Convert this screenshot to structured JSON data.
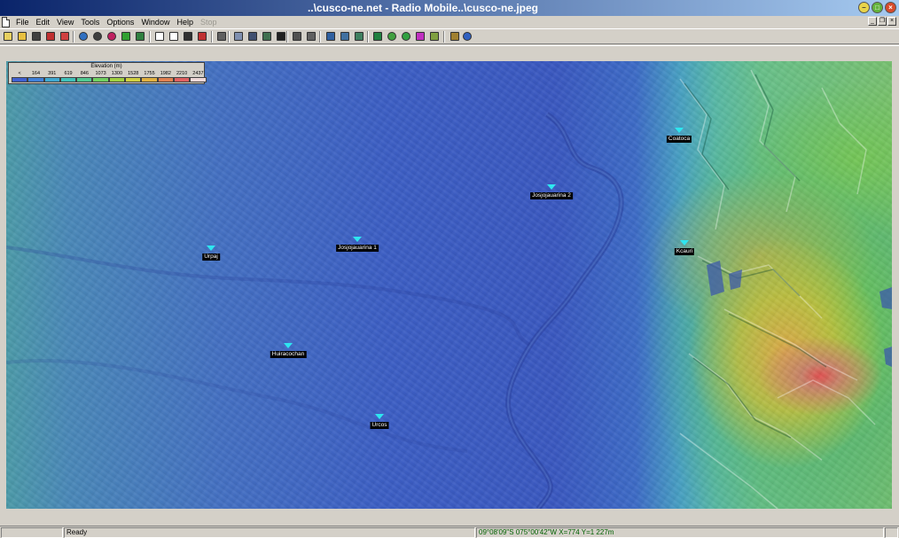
{
  "window": {
    "title": "..\\cusco-ne.net - Radio Mobile..\\cusco-ne.jpeg"
  },
  "menu": {
    "items": [
      {
        "label": "File",
        "enabled": true
      },
      {
        "label": "Edit",
        "enabled": true
      },
      {
        "label": "View",
        "enabled": true
      },
      {
        "label": "Tools",
        "enabled": true
      },
      {
        "label": "Options",
        "enabled": true
      },
      {
        "label": "Window",
        "enabled": true
      },
      {
        "label": "Help",
        "enabled": true
      },
      {
        "label": "Stop",
        "enabled": false
      }
    ]
  },
  "toolbar": {
    "buttons": [
      {
        "icon": "new-icon",
        "color": "#e8d060"
      },
      {
        "icon": "open-icon",
        "color": "#e8c040"
      },
      {
        "icon": "save-icon",
        "color": "#404040"
      },
      {
        "icon": "properties-icon",
        "color": "#c03030"
      },
      {
        "icon": "link-tool-icon",
        "color": "#d04040"
      },
      {
        "icon": "globe-icon",
        "color": "#3070c0"
      },
      {
        "icon": "map-extract-icon",
        "color": "#404040"
      },
      {
        "icon": "map-merge-icon",
        "color": "#c02060"
      },
      {
        "icon": "arrow-left-icon",
        "color": "#30a030"
      },
      {
        "icon": "arrow-right-icon",
        "color": "#308040"
      },
      {
        "icon": "page-icon",
        "color": "#ffffff"
      },
      {
        "icon": "page-save-icon",
        "color": "#ffffff"
      },
      {
        "icon": "disk-icon",
        "color": "#303030"
      },
      {
        "icon": "pdf-icon",
        "color": "#c03030"
      },
      {
        "icon": "print-icon",
        "color": "#606060"
      },
      {
        "icon": "copy-icon",
        "color": "#8090b0"
      },
      {
        "icon": "picture-icon",
        "color": "#405070"
      },
      {
        "icon": "landscape-icon",
        "color": "#407050"
      },
      {
        "icon": "grayscale-icon",
        "color": "#202020"
      },
      {
        "icon": "scale-icon",
        "color": "#505050"
      },
      {
        "icon": "grid-icon",
        "color": "#606060"
      },
      {
        "icon": "window-icon",
        "color": "#3060a0"
      },
      {
        "icon": "zoom-icon",
        "color": "#4070a0"
      },
      {
        "icon": "fit-icon",
        "color": "#408060"
      },
      {
        "icon": "radio-link-icon",
        "color": "#208040"
      },
      {
        "icon": "polar-plot-icon",
        "color": "#40a040"
      },
      {
        "icon": "coverage-icon",
        "color": "#30a040"
      },
      {
        "icon": "cartesian-icon",
        "color": "#c030c0"
      },
      {
        "icon": "route-icon",
        "color": "#80a040"
      },
      {
        "icon": "settings-icon",
        "color": "#a08030"
      },
      {
        "icon": "world-icon",
        "color": "#3060c0"
      }
    ]
  },
  "legend": {
    "title": "Elevation (m)",
    "ticks": [
      "<",
      "164",
      "391",
      "619",
      "846",
      "1073",
      "1300",
      "1528",
      "1755",
      "1982",
      "2210",
      "2437"
    ],
    "colors": [
      "#4060d0",
      "#4080d8",
      "#40a8d0",
      "#40c0b8",
      "#50c890",
      "#70d060",
      "#a0d040",
      "#d0d040",
      "#e0b040",
      "#e08050",
      "#e06060",
      "#f0d8d8"
    ]
  },
  "units": [
    {
      "name": "Coatoca",
      "color": "#2ee6f0"
    },
    {
      "name": "Josjojauarina 2",
      "color": "#2ee6f0"
    },
    {
      "name": "Josjojauarina 1",
      "color": "#2ee6f0"
    },
    {
      "name": "Urpaj",
      "color": "#2ee6f0"
    },
    {
      "name": "Kcauri",
      "color": "#2ee6f0"
    },
    {
      "name": "Huiracochan",
      "color": "#2ee6f0"
    },
    {
      "name": "Urcos",
      "color": "#2ee6f0"
    }
  ],
  "status": {
    "text": "Ready",
    "coords": "09°08'09\"S 075°00'42\"W  X=774 Y=1 227m"
  }
}
